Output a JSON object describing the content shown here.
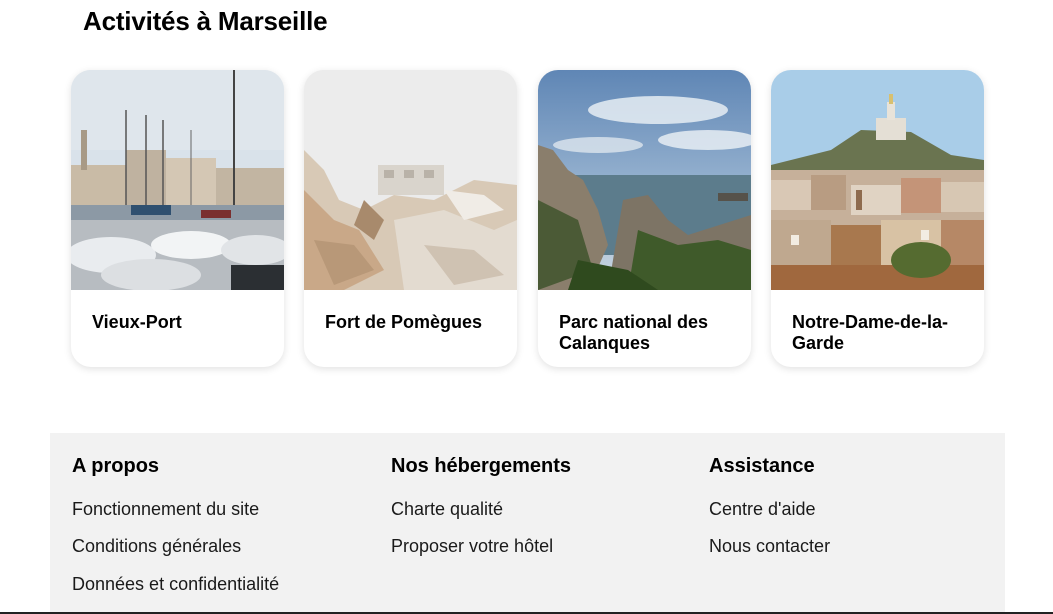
{
  "section": {
    "title": "Activités à Marseille"
  },
  "cards": [
    {
      "label": "Vieux-Port",
      "image": "harbor-photo"
    },
    {
      "label": "Fort de Pomègues",
      "image": "fort-photo"
    },
    {
      "label": "Parc national des Calanques",
      "image": "calanques-photo"
    },
    {
      "label": "Notre-Dame-de-la-Garde",
      "image": "basilica-photo"
    }
  ],
  "footer": {
    "columns": [
      {
        "title": "A propos",
        "links": [
          "Fonctionnement du site",
          "Conditions générales",
          "Données et confidentialité"
        ]
      },
      {
        "title": "Nos hébergements",
        "links": [
          "Charte qualité",
          "Proposer votre hôtel"
        ]
      },
      {
        "title": "Assistance",
        "links": [
          "Centre d'aide",
          "Nous contacter"
        ]
      }
    ]
  }
}
